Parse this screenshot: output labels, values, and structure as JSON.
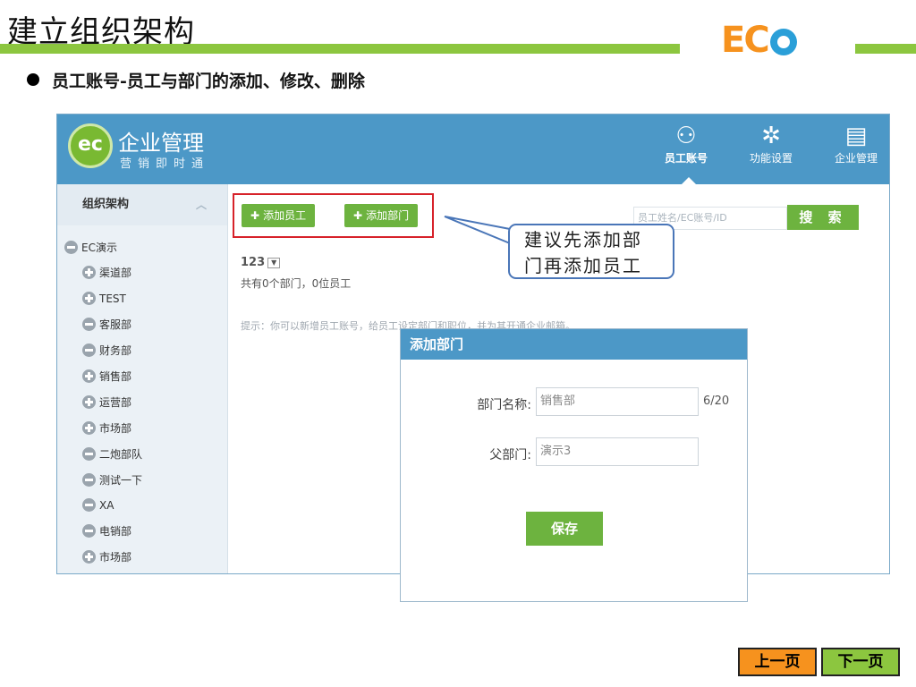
{
  "slide": {
    "title": "建立组织架构",
    "bullet": "员工账号-员工与部门的添加、修改、删除",
    "logo_text": "EC"
  },
  "app": {
    "logo_text": "ec",
    "name": "企业管理",
    "subtitle": "营销即时通",
    "nav": [
      {
        "label": "员工账号",
        "icon": "users-icon",
        "active": true
      },
      {
        "label": "功能设置",
        "icon": "gear-icon",
        "active": false
      },
      {
        "label": "企业管理",
        "icon": "id-card-icon",
        "active": false
      }
    ],
    "nav_icons": [
      "⚇",
      "✲",
      "▤"
    ]
  },
  "sidebar": {
    "title": "组织架构",
    "items": [
      {
        "label": "EC演示",
        "type": "minus"
      },
      {
        "label": "渠道部",
        "type": "plus"
      },
      {
        "label": "TEST",
        "type": "plus"
      },
      {
        "label": "客服部",
        "type": "minus"
      },
      {
        "label": "财务部",
        "type": "minus"
      },
      {
        "label": "销售部",
        "type": "plus"
      },
      {
        "label": "运营部",
        "type": "plus"
      },
      {
        "label": "市场部",
        "type": "plus"
      },
      {
        "label": "二炮部队",
        "type": "minus"
      },
      {
        "label": "测试一下",
        "type": "minus"
      },
      {
        "label": "XA",
        "type": "minus"
      },
      {
        "label": "电销部",
        "type": "minus"
      },
      {
        "label": "市场部",
        "type": "plus"
      }
    ]
  },
  "main": {
    "add_employee": "添加员工",
    "add_department": "添加部门",
    "search_placeholder": "员工姓名/EC账号/ID",
    "search_button": "搜 索",
    "org_name": "123",
    "count_text": "共有0个部门，0位员工",
    "hint": "提示：你可以新增员工账号，给员工设定部门和职位，并为其开通企业邮箱。"
  },
  "callout": {
    "line1": "建议先添加部",
    "line2": "门再添加员工"
  },
  "modal": {
    "title": "添加部门",
    "dept_label": "部门名称:",
    "dept_value": "销售部",
    "dept_count": "6/20",
    "parent_label": "父部门:",
    "parent_value": "演示3",
    "save": "保存"
  },
  "paging": {
    "prev": "上一页",
    "next": "下一页"
  },
  "colors": {
    "header_blue": "#4c98c7",
    "accent_green": "#6db33f",
    "slide_green": "#8cc63f",
    "orange": "#f6921e",
    "highlight_red": "#d7222a"
  }
}
